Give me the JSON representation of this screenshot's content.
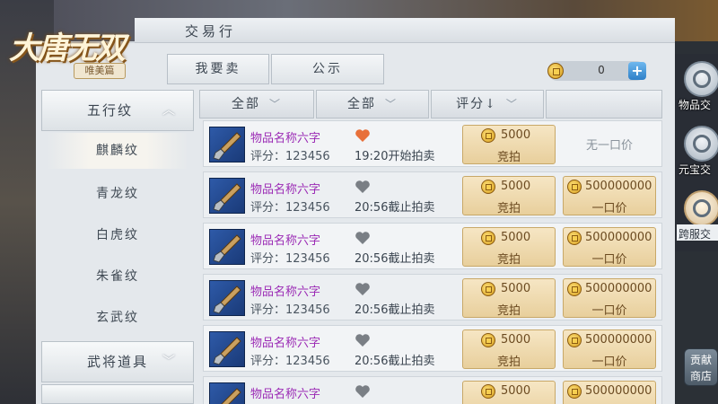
{
  "logo": {
    "title": "大唐无双",
    "sub": "唯美篇"
  },
  "panel": {
    "title": "交易行"
  },
  "tabs": [
    {
      "label": "我要卖"
    },
    {
      "label": "公示"
    }
  ],
  "currency": {
    "value": "0",
    "plus": "+"
  },
  "sidebar": {
    "categories": [
      {
        "label": "五行纹",
        "expanded": true
      },
      {
        "label": "武将道具",
        "expanded": false
      }
    ],
    "items": [
      {
        "label": "麒麟纹",
        "active": true
      },
      {
        "label": "青龙纹"
      },
      {
        "label": "白虎纹"
      },
      {
        "label": "朱雀纹"
      },
      {
        "label": "玄武纹"
      }
    ]
  },
  "table_headers": [
    {
      "label": "全部",
      "dropdown": true
    },
    {
      "label": "全部",
      "dropdown": true
    },
    {
      "label": "评分↓",
      "dropdown": true
    },
    {
      "label": "",
      "dropdown": false
    }
  ],
  "rows": [
    {
      "name": "物品名称六字",
      "score": "评分：123456",
      "favorited": true,
      "time": "19:20开始拍卖",
      "bid_amount": "5000",
      "bid_label": "竞拍",
      "buyout_amount": "",
      "buyout_label": "",
      "no_buyout": "无一口价"
    },
    {
      "name": "物品名称六字",
      "score": "评分：123456",
      "favorited": false,
      "time": "20:56截止拍卖",
      "bid_amount": "5000",
      "bid_label": "竞拍",
      "buyout_amount": "500000000",
      "buyout_label": "一口价",
      "no_buyout": ""
    },
    {
      "name": "物品名称六字",
      "score": "评分：123456",
      "favorited": false,
      "time": "20:56截止拍卖",
      "bid_amount": "5000",
      "bid_label": "竞拍",
      "buyout_amount": "500000000",
      "buyout_label": "一口价",
      "no_buyout": ""
    },
    {
      "name": "物品名称六字",
      "score": "评分：123456",
      "favorited": false,
      "time": "20:56截止拍卖",
      "bid_amount": "5000",
      "bid_label": "竞拍",
      "buyout_amount": "500000000",
      "buyout_label": "一口价",
      "no_buyout": ""
    },
    {
      "name": "物品名称六字",
      "score": "评分：123456",
      "favorited": false,
      "time": "20:56截止拍卖",
      "bid_amount": "5000",
      "bid_label": "竞拍",
      "buyout_amount": "500000000",
      "buyout_label": "一口价",
      "no_buyout": ""
    },
    {
      "name": "物品名称六字",
      "score": "",
      "favorited": false,
      "time": "",
      "bid_amount": "5000",
      "bid_label": "",
      "buyout_amount": "500000000",
      "buyout_label": "",
      "no_buyout": ""
    }
  ],
  "right_nav": [
    {
      "label": "物品交",
      "active": false
    },
    {
      "label": "元宝交",
      "active": false
    },
    {
      "label": "跨服交",
      "active": true
    }
  ],
  "shop": {
    "line1": "贡献",
    "line2": "商店"
  },
  "colors": {
    "item_name": "#9b2bb5",
    "heart_active": "#e8703a",
    "heart_inactive": "#7a7f85",
    "bid_bg": "#f0dcb0"
  }
}
